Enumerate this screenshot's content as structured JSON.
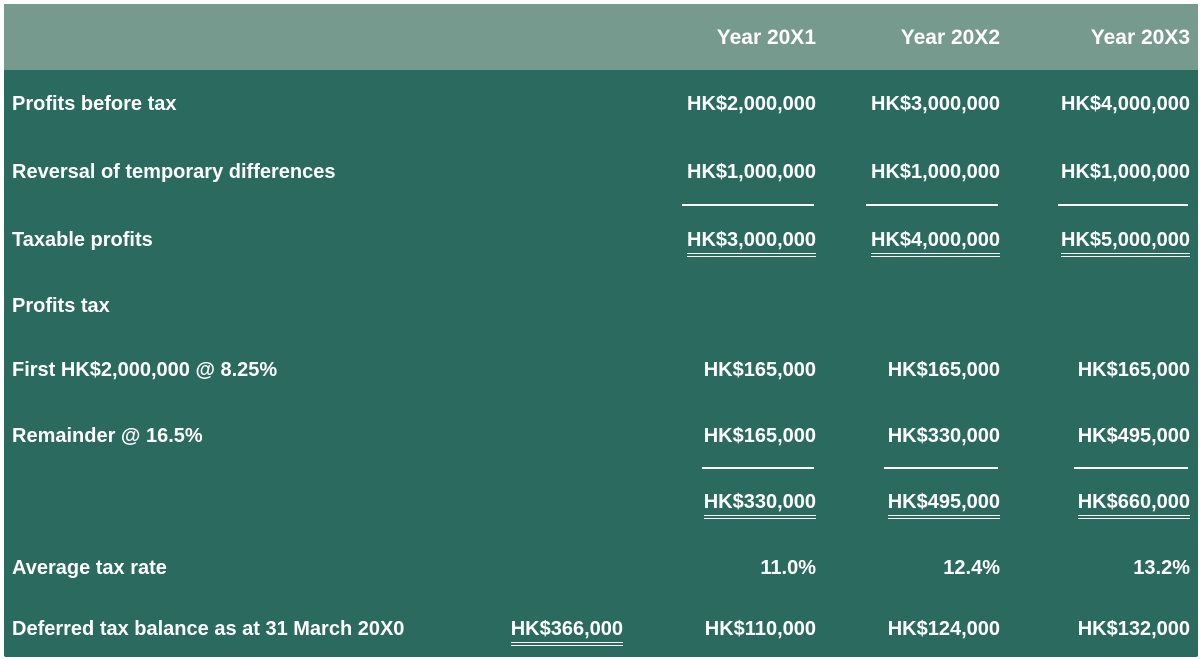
{
  "header": {
    "col1": "Year 20X1",
    "col2": "Year 20X2",
    "col3": "Year 20X3"
  },
  "rows": {
    "pbt": {
      "label": "Profits before tax",
      "v1": "HK$2,000,000",
      "v2": "HK$3,000,000",
      "v3": "HK$4,000,000"
    },
    "rev": {
      "label": "Reversal of temporary differences",
      "v1": "HK$1,000,000",
      "v2": "HK$1,000,000",
      "v3": "HK$1,000,000"
    },
    "tp": {
      "label": "Taxable profits",
      "v1": "HK$3,000,000",
      "v2": "HK$4,000,000",
      "v3": "HK$5,000,000"
    },
    "pt": {
      "label": "Profits tax"
    },
    "first": {
      "label": "First HK$2,000,000 @ 8.25%",
      "v1": "HK$165,000",
      "v2": "HK$165,000",
      "v3": "HK$165,000"
    },
    "rem": {
      "label": "Remainder @ 16.5%",
      "v1": "HK$165,000",
      "v2": "HK$330,000",
      "v3": "HK$495,000"
    },
    "total": {
      "v1": "HK$330,000",
      "v2": "HK$495,000",
      "v3": "HK$660,000"
    },
    "avg": {
      "label": "Average tax rate",
      "v1": "11.0%",
      "v2": "12.4%",
      "v3": "13.2%"
    },
    "def": {
      "label": "Deferred tax balance as at 31 March 20X0",
      "v0": "HK$366,000",
      "v1": "HK$110,000",
      "v2": "HK$124,000",
      "v3": "HK$132,000"
    }
  }
}
